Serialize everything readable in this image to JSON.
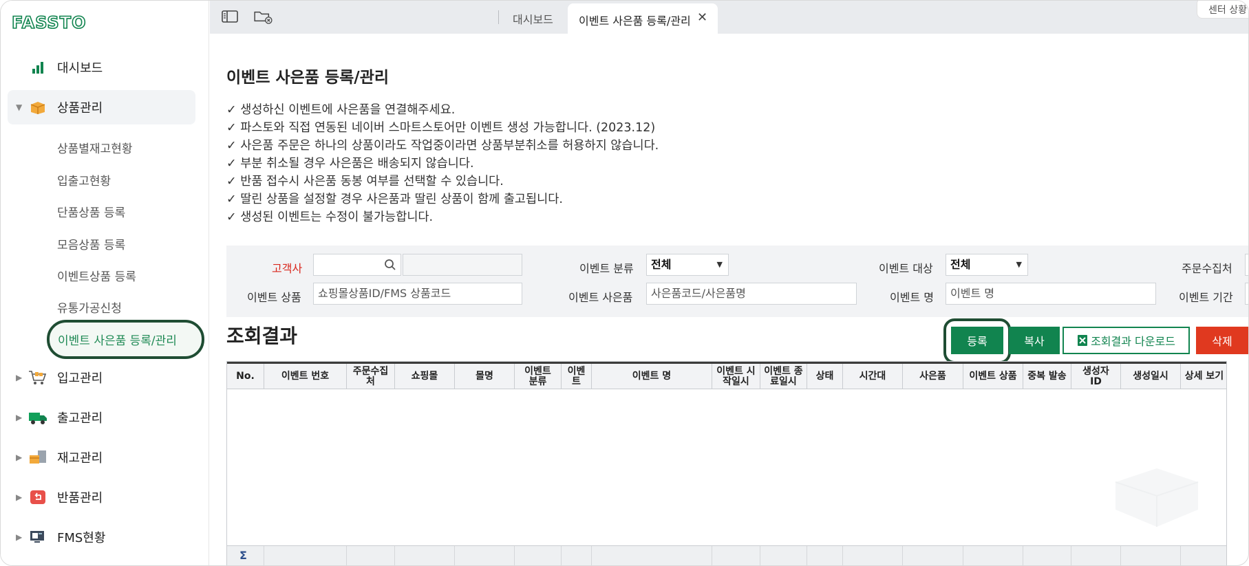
{
  "app": {
    "logo_text": "FASSTO"
  },
  "sidebar": {
    "dashboard": "대시보드",
    "product_group": "상품관리",
    "sub_items": [
      "상품별재고현황",
      "입출고현황",
      "단품상품 등록",
      "모음상품 등록",
      "이벤트상품 등록",
      "유통가공신청"
    ],
    "sub_active": "이벤트 사은품 등록/관리",
    "groups": [
      "입고관리",
      "출고관리",
      "재고관리",
      "반품관리",
      "FMS현황"
    ]
  },
  "tabs": {
    "dashboard": "대시보드",
    "active": "이벤트 사은품 등록/관리",
    "close": "✕",
    "center_chip": "센터 상황"
  },
  "page": {
    "title": "이벤트 사은품 등록/관리",
    "notes": [
      "✓ 생성하신 이벤트에 사은품을 연결해주세요.",
      "✓ 파스토와 직접 연동된 네이버 스마트스토어만 이벤트 생성 가능합니다. (2023.12)",
      "✓ 사은품 주문은 하나의 상품이라도 작업중이라면 상품부분취소를 허용하지 않습니다.",
      "✓ 부분 취소될 경우 사은품은 배송되지 않습니다.",
      "✓ 반품 접수시 사은품 동봉 여부를 선택할 수 있습니다.",
      "✓ 딸린 상품을 설정할 경우 사은품과 딸린 상품이 함께 출고됩니다.",
      "✓ 생성된 이벤트는 수정이 불가능합니다."
    ]
  },
  "filter": {
    "customer_label": "고객사",
    "event_type_label": "이벤트 분류",
    "event_type_value": "전체",
    "event_target_label": "이벤트 대상",
    "event_target_value": "전체",
    "order_source_label": "주문수집처",
    "event_product_label": "이벤트 상품",
    "event_product_placeholder": "쇼핑몰상품ID/FMS 상품코드",
    "gift_label": "이벤트 사은품",
    "gift_placeholder": "사은품코드/사은품명",
    "event_name_label": "이벤트 명",
    "event_name_placeholder": "이벤트 명",
    "event_period_label": "이벤트 기간"
  },
  "results": {
    "title": "조회결과",
    "buttons": {
      "register": "등록",
      "copy": "복사",
      "download": "조회결과 다운로드",
      "delete": "삭제"
    },
    "columns": [
      "No.",
      "이벤트 번호",
      "주문수집처",
      "쇼핑몰",
      "몰명",
      "이벤트 분류",
      "이벤트",
      "이벤트 명",
      "이벤트 시작일시",
      "이벤트 종료일시",
      "상태",
      "시간대",
      "사은품",
      "이벤트 상품",
      "중복 발송",
      "생성자 ID",
      "생성일시",
      "상세 보기"
    ],
    "footer_symbol": "Σ"
  },
  "colors": {
    "brand": "#11844f",
    "danger": "#e0391f",
    "required": "#d9261c"
  }
}
